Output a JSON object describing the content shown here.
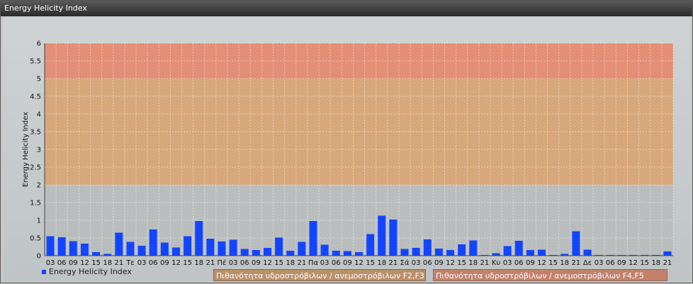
{
  "window": {
    "title": "Energy Helicity Index"
  },
  "colors": {
    "bar": "#1245ff",
    "zone_low": "#b9bcbc",
    "zone_mid": "#d6a679",
    "zone_high": "#e38d74"
  },
  "legend": {
    "series_label": "Energy Helicity Index"
  },
  "zones": {
    "f2f3": "Πιθανότητα υδροστρόβιλων / ανεμοστρόβιλων F2,F3",
    "f4f5": "Πιθανότητα υδροστρόβιλων / ανεμοστρόβιλων F4,F5"
  },
  "chart_data": {
    "type": "bar",
    "ylabel": "Energy Helicity Index",
    "ylim": [
      0,
      6
    ],
    "yticks": [
      "0",
      "0.5",
      "1",
      "1.5",
      "2",
      "2.5",
      "3",
      "3.5",
      "4",
      "4.5",
      "5",
      "5.5",
      "6"
    ],
    "bands": [
      {
        "from": 0,
        "to": 2,
        "color": "#b9bcbc"
      },
      {
        "from": 2,
        "to": 5,
        "color": "#d6a679"
      },
      {
        "from": 5,
        "to": 6,
        "color": "#e38d74"
      }
    ],
    "categories": [
      "03",
      "06",
      "09",
      "12",
      "15",
      "18",
      "21",
      "Τε",
      "03",
      "06",
      "09",
      "12",
      "15",
      "18",
      "21",
      "Πέ",
      "03",
      "06",
      "09",
      "12",
      "15",
      "18",
      "21",
      "Πα",
      "03",
      "06",
      "09",
      "12",
      "15",
      "18",
      "21",
      "Σά",
      "03",
      "06",
      "09",
      "12",
      "15",
      "18",
      "21",
      "Κυ",
      "03",
      "06",
      "09",
      "12",
      "15",
      "18",
      "21",
      "Δε",
      "03",
      "06",
      "09",
      "12",
      "15",
      "18",
      "21"
    ],
    "series": [
      {
        "name": "Energy Helicity Index",
        "values": [
          0.55,
          0.52,
          0.41,
          0.34,
          0.1,
          0.05,
          0.65,
          0.39,
          0.28,
          0.74,
          0.37,
          0.23,
          0.55,
          0.98,
          0.48,
          0.4,
          0.45,
          0.19,
          0.16,
          0.22,
          0.51,
          0.14,
          0.39,
          0.98,
          0.31,
          0.14,
          0.13,
          0.1,
          0.61,
          1.13,
          1.02,
          0.19,
          0.22,
          0.46,
          0.2,
          0.16,
          0.32,
          0.43,
          0.01,
          0.07,
          0.27,
          0.42,
          0.16,
          0.17,
          0.02,
          0.05,
          0.69,
          0.17,
          0.02,
          0.02,
          0.02,
          0.02,
          0.02,
          0.02,
          0.12
        ]
      }
    ]
  }
}
